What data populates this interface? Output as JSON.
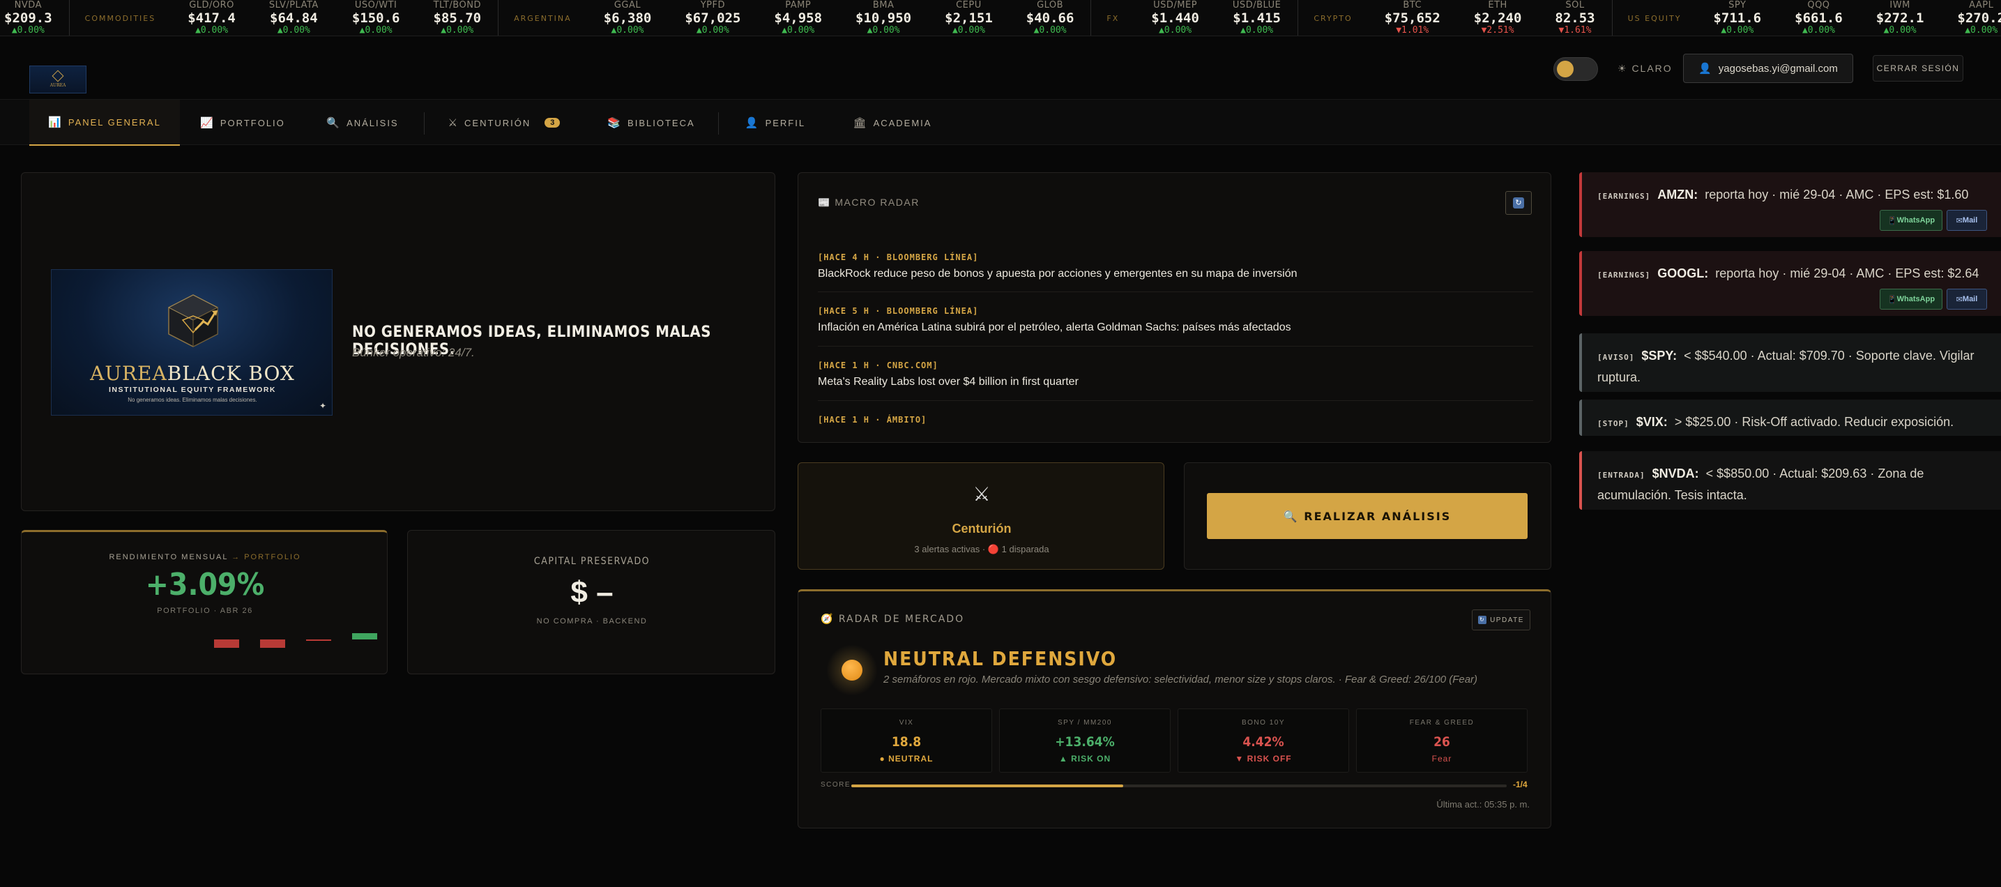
{
  "ticker": {
    "items": [
      {
        "kind": "quote",
        "sym": "NVDA",
        "px": "$209.3",
        "chg": "▲0.00%",
        "dir": "up"
      },
      {
        "kind": "group",
        "label": "COMMODITIES"
      },
      {
        "kind": "quote",
        "sym": "GLD/ORO",
        "px": "$417.4",
        "chg": "▲0.00%",
        "dir": "up"
      },
      {
        "kind": "quote",
        "sym": "SLV/PLATA",
        "px": "$64.84",
        "chg": "▲0.00%",
        "dir": "up"
      },
      {
        "kind": "quote",
        "sym": "USO/WTI",
        "px": "$150.6",
        "chg": "▲0.00%",
        "dir": "up"
      },
      {
        "kind": "quote",
        "sym": "TLT/BOND",
        "px": "$85.70",
        "chg": "▲0.00%",
        "dir": "up"
      },
      {
        "kind": "group",
        "label": "ARGENTINA"
      },
      {
        "kind": "quote",
        "sym": "GGAL",
        "px": "$6,380",
        "chg": "▲0.00%",
        "dir": "up"
      },
      {
        "kind": "quote",
        "sym": "YPFD",
        "px": "$67,025",
        "chg": "▲0.00%",
        "dir": "up"
      },
      {
        "kind": "quote",
        "sym": "PAMP",
        "px": "$4,958",
        "chg": "▲0.00%",
        "dir": "up"
      },
      {
        "kind": "quote",
        "sym": "BMA",
        "px": "$10,950",
        "chg": "▲0.00%",
        "dir": "up"
      },
      {
        "kind": "quote",
        "sym": "CEPU",
        "px": "$2,151",
        "chg": "▲0.00%",
        "dir": "up"
      },
      {
        "kind": "quote",
        "sym": "GLOB",
        "px": "$40.66",
        "chg": "▲0.00%",
        "dir": "up"
      },
      {
        "kind": "group",
        "label": "FX"
      },
      {
        "kind": "quote",
        "sym": "USD/MEP",
        "px": "$1.440",
        "chg": "▲0.00%",
        "dir": "up"
      },
      {
        "kind": "quote",
        "sym": "USD/BLUE",
        "px": "$1.415",
        "chg": "▲0.00%",
        "dir": "up"
      },
      {
        "kind": "group",
        "label": "CRYPTO"
      },
      {
        "kind": "quote",
        "sym": "BTC",
        "px": "$75,652",
        "chg": "▼1.01%",
        "dir": "dn"
      },
      {
        "kind": "quote",
        "sym": "ETH",
        "px": "$2,240",
        "chg": "▼2.51%",
        "dir": "dn"
      },
      {
        "kind": "quote",
        "sym": "SOL",
        "px": "82.53",
        "chg": "▼1.61%",
        "dir": "dn"
      },
      {
        "kind": "group",
        "label": "US EQUITY"
      },
      {
        "kind": "quote",
        "sym": "SPY",
        "px": "$711.6",
        "chg": "▲0.00%",
        "dir": "up"
      },
      {
        "kind": "quote",
        "sym": "QQQ",
        "px": "$661.6",
        "chg": "▲0.00%",
        "dir": "up"
      },
      {
        "kind": "quote",
        "sym": "IWM",
        "px": "$272.1",
        "chg": "▲0.00%",
        "dir": "up"
      },
      {
        "kind": "quote",
        "sym": "AAPL",
        "px": "$270.2",
        "chg": "▲0.00%",
        "dir": "up"
      }
    ]
  },
  "header": {
    "theme_label": "☀ CLARO",
    "user_email": "yagosebas.yi@gmail.com",
    "logout_label": "CERRAR SESIÓN"
  },
  "nav": {
    "tabs": [
      {
        "icon": "📊",
        "label": "PANEL GENERAL"
      },
      {
        "icon": "📈",
        "label": "PORTFOLIO"
      },
      {
        "icon": "🔍",
        "label": "ANÁLISIS"
      },
      {
        "icon": "⚔",
        "label": "CENTURIÓN",
        "badge": "3"
      },
      {
        "icon": "📚",
        "label": "BIBLIOTECA"
      },
      {
        "icon": "👤",
        "label": "PERFIL"
      },
      {
        "icon": "🏛",
        "label": "ACADEMIA"
      }
    ]
  },
  "hero": {
    "brand_gold": "AUREA",
    "brand_light": "BLACK BOX",
    "brand_sub": "INSTITUTIONAL EQUITY FRAMEWORK",
    "brand_tagline": "No generamos ideas. Eliminamos malas decisiones.",
    "title": "NO GENERAMOS IDEAS, ELIMINAMOS MALAS DECISIONES.",
    "subtitle": "Búnker operativo: 24/7."
  },
  "performance": {
    "label": "RENDIMIENTO MENSUAL",
    "link": "→ PORTFOLIO",
    "value": "+3.09%",
    "caption": "PORTFOLIO · ABR 26",
    "bars": [
      {
        "value": -1.0,
        "color": "#b83a36"
      },
      {
        "value": -1.0,
        "color": "#b83a36"
      },
      {
        "value": -0.15,
        "color": "#b83a36"
      },
      {
        "value": 0.75,
        "color": "#3fa55f"
      }
    ]
  },
  "capital": {
    "label": "CAPITAL PRESERVADO",
    "value": "$ –",
    "caption": "NO COMPRA · BACKEND"
  },
  "macro": {
    "title": "📰 MACRO RADAR",
    "news": [
      {
        "meta": "[HACE 4 H · BLOOMBERG LÍNEA]",
        "headline": "BlackRock reduce peso de bonos y apuesta por acciones y emergentes en su mapa de inversión"
      },
      {
        "meta": "[HACE 5 H · BLOOMBERG LÍNEA]",
        "headline": "Inflación en América Latina subirá por el petróleo, alerta Goldman Sachs: países más afectados"
      },
      {
        "meta": "[HACE 1 H · CNBC.COM]",
        "headline": "Meta's Reality Labs lost over $4 billion in first quarter"
      },
      {
        "meta": "[HACE 1 H · ÁMBITO]",
        "headline": ""
      }
    ]
  },
  "centurion": {
    "icon": "⚔",
    "name": "Centurión",
    "stats": "3 alertas activas · 🔴 1 disparada"
  },
  "analysis_button": {
    "label": "🔍 REALIZAR ANÁLISIS"
  },
  "radar": {
    "title": "🧭 RADAR DE MERCADO",
    "update_label": "UPDATE",
    "state": "NEUTRAL DEFENSIVO",
    "description": "2 semáforos en rojo. Mercado mixto con sesgo defensivo: selectividad, menor size y stops claros. · Fear & Greed: 26/100 (Fear)",
    "metrics": [
      {
        "label": "VIX",
        "value": "18.8",
        "status": "● NEUTRAL",
        "color": "amber"
      },
      {
        "label": "SPY / MM200",
        "value": "+13.64%",
        "status": "▲ RISK ON",
        "color": "green"
      },
      {
        "label": "BONO 10Y",
        "value": "4.42%",
        "status": "▼ RISK OFF",
        "color": "red"
      },
      {
        "label": "FEAR & GREED",
        "value": "26",
        "status": "Fear",
        "color": "red"
      }
    ],
    "score_label": "SCORE",
    "score_fraction": 0.415,
    "score_value": "-1/4",
    "updated": "Última act.: 05:35 p. m."
  },
  "alerts": [
    {
      "tag": "[EARNINGS]",
      "sym": "AMZN:",
      "text": "reporta hoy · mié 29-04 · AMC · EPS est: $1.60",
      "style": "red",
      "buttons": true
    },
    {
      "tag": "[EARNINGS]",
      "sym": "GOOGL:",
      "text": "reporta hoy · mié 29-04 · AMC · EPS est: $2.64",
      "style": "red",
      "buttons": true
    },
    {
      "tag": "[AVISO]",
      "sym": "$SPY:",
      "text": "< $$540.00 · Actual: $709.70 · Soporte clave. Vigilar ruptura.",
      "style": "gray",
      "buttons": false
    },
    {
      "tag": "[STOP]",
      "sym": "$VIX:",
      "text": "> $$25.00 · Risk-Off activado. Reducir exposición.",
      "style": "gray",
      "buttons": false
    },
    {
      "tag": "[ENTRADA]",
      "sym": "$NVDA:",
      "text": "< $$850.00 · Actual: $209.63 · Zona de acumulación. Tesis intacta.",
      "style": "dark",
      "buttons": false
    }
  ],
  "alert_buttons": {
    "whatsapp": "WhatsApp",
    "mail": "Mail"
  }
}
